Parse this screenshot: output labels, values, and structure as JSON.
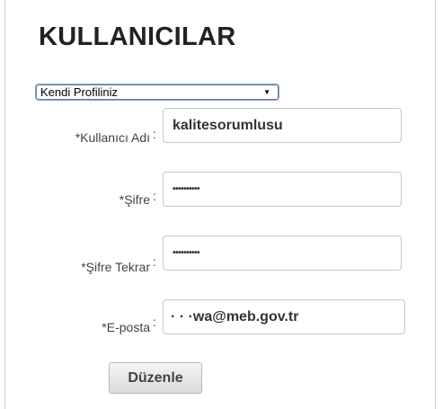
{
  "page": {
    "title": "KULLANICILAR"
  },
  "profile_select": {
    "selected": "Kendi Profiliniz",
    "arrow": "▼"
  },
  "form": {
    "username": {
      "label": "*Kullanıcı Adı",
      "colon": ":",
      "value": "kalitesorumlusu"
    },
    "password": {
      "label": "*Şifre",
      "colon": ":",
      "value": "••••••••••"
    },
    "password_repeat": {
      "label": "*Şifre Tekrar",
      "colon": ":",
      "value": "••••••••••"
    },
    "email": {
      "label": "*E-posta",
      "colon": ":",
      "value": "·                   ·          ·wa@meb.gov.tr"
    }
  },
  "actions": {
    "edit_label": "Düzenle"
  }
}
